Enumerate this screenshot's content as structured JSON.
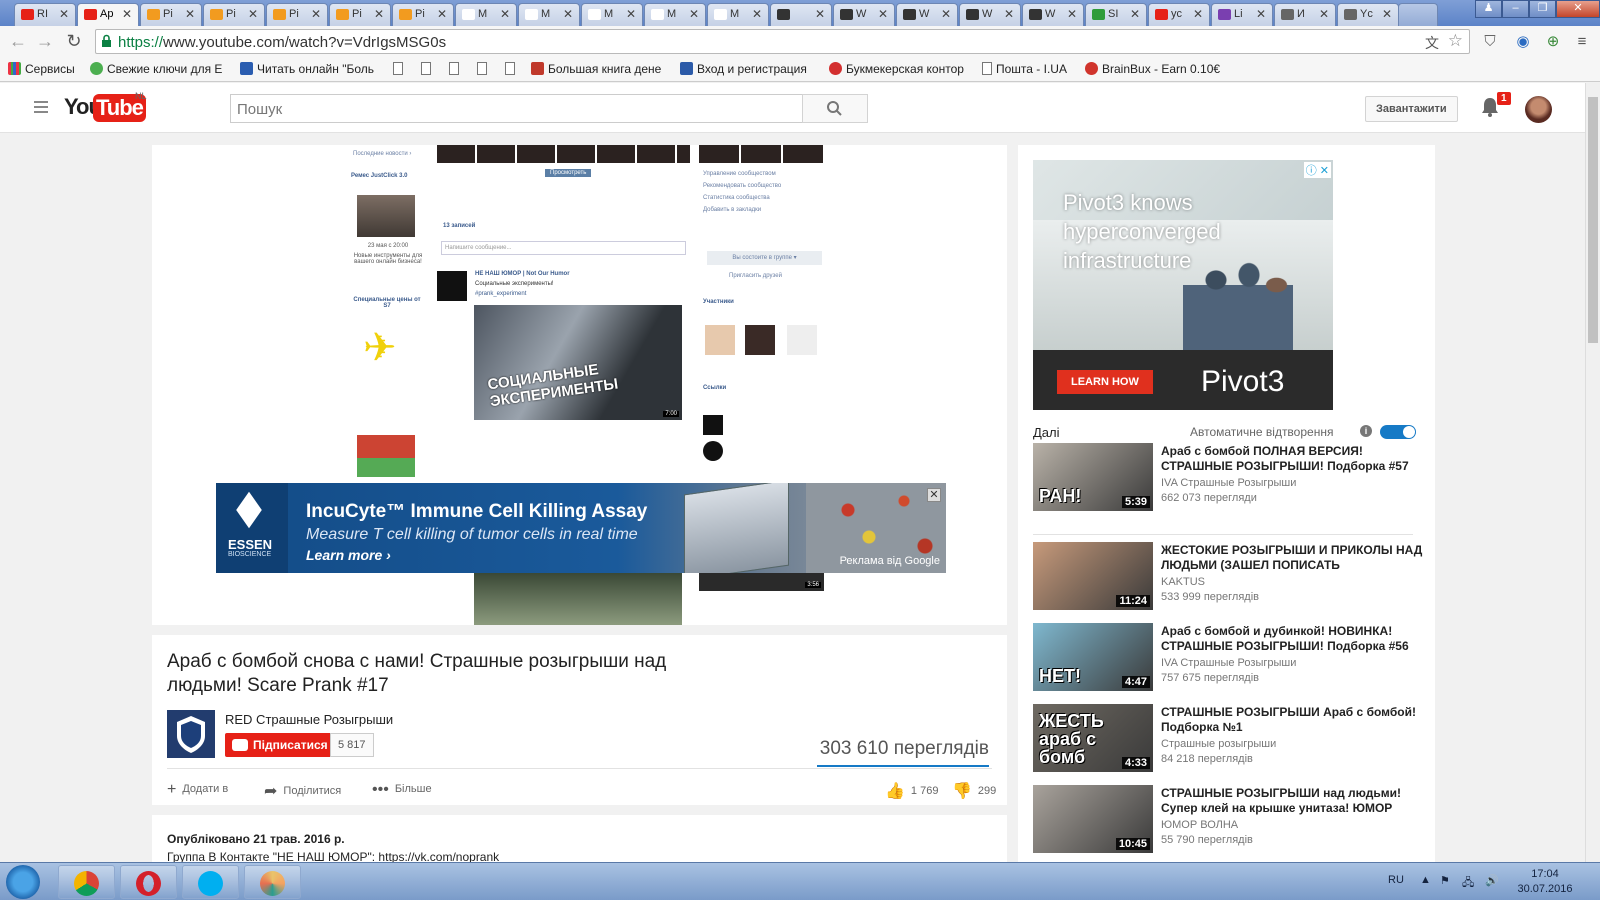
{
  "browser": {
    "tabs": [
      {
        "label": "RI",
        "color": "#e62117"
      },
      {
        "label": "Ap",
        "color": "#e62117"
      },
      {
        "label": "Pi",
        "color": "#f29b1f"
      },
      {
        "label": "Pi",
        "color": "#f29b1f"
      },
      {
        "label": "Pi",
        "color": "#f29b1f"
      },
      {
        "label": "Pi",
        "color": "#f29b1f"
      },
      {
        "label": "Pi",
        "color": "#f29b1f"
      },
      {
        "label": "M",
        "color": "#ffffff"
      },
      {
        "label": "M",
        "color": "#ffffff"
      },
      {
        "label": "M",
        "color": "#ffffff"
      },
      {
        "label": "M",
        "color": "#ffffff"
      },
      {
        "label": "M",
        "color": "#ffffff"
      },
      {
        "label": "",
        "color": "#333333"
      },
      {
        "label": "W",
        "color": "#333333"
      },
      {
        "label": "W",
        "color": "#333333"
      },
      {
        "label": "W",
        "color": "#333333"
      },
      {
        "label": "W",
        "color": "#333333"
      },
      {
        "label": "SI",
        "color": "#2e9c3a"
      },
      {
        "label": "yc",
        "color": "#e62117"
      },
      {
        "label": "Li",
        "color": "#7a3fb0"
      },
      {
        "label": "И",
        "color": "#666666"
      },
      {
        "label": "Yc",
        "color": "#666666"
      }
    ],
    "url_scheme": "https://",
    "url_rest": "www.youtube.com/watch?v=VdrIgsMSG0s",
    "bookmarks": [
      "Сервисы",
      "Свежие ключи для E",
      "Читать онлайн \"Боль",
      "Большая книга дене",
      "Вход и регистрация",
      "Букмекерская контор",
      "Пошта - I.UA",
      "BrainBux - Earn 0.10€"
    ]
  },
  "youtube": {
    "logo_you": "You",
    "logo_tube": "Tube",
    "logo_region": "NL",
    "search_placeholder": "Пошук",
    "upload_label": "Завантажити",
    "notification_count": "1"
  },
  "player": {
    "ad_title": "IncuCyte™ Immune Cell Killing Assay",
    "ad_sub": "Measure T cell killing of tumor cells in real time",
    "ad_learn": "Learn more ›",
    "ad_brand": "ESSEN",
    "ad_brand_sub": "BIOSCIENCE",
    "ad_attribution": "Реклама від Google",
    "ad_close": "✕",
    "screen_text": {
      "latest_news": "Последние новости ›",
      "promo_name": "Ремес JustClick 3.0",
      "promo_date": "23 мая с 20:00",
      "promo_text": "Новые инструменты для вашего онлайн бизнеса!",
      "special_domain": "Специальные цены от S7",
      "post_count": "13 записей",
      "post_placeholder": "Напишите сообщение...",
      "group_name": "НЕ НАШ ЮМОР | Not Our Humor",
      "post_text": "Социальные эксперименты!",
      "hashtag": "#prank_experiment",
      "video_overlay": "СОЦИАЛЬНЫЕ ЭКСПЕРИМЕНТЫ",
      "video_time": "7:00",
      "members": "Участники",
      "links": "Ссылки",
      "join": "Вы состоите в группе ▾",
      "invite": "Пригласить друзей",
      "manage": "Управление сообществом",
      "recommend": "Рекомендовать сообщество",
      "stats": "Статистика сообщества",
      "bookmark": "Добавить в закладки",
      "view_btn": "Просмотреть",
      "second_time": "3:56"
    }
  },
  "video": {
    "title": "Араб с бомбой снова с нами! Страшные розыгрыши над людьми! Scare Prank #17",
    "channel": "RED Страшные Розыгрыши",
    "subscribe_label": "Підписатися",
    "subscriber_count": "5 817",
    "views": "303 610 переглядів",
    "add_to": "Додати в",
    "share": "Поділитися",
    "more": "Більше",
    "likes": "1 769",
    "dislikes": "299",
    "published": "Опубліковано 21 трав. 2016 р.",
    "desc_line": "Группа В Контакте \"НЕ НАШ ЮМОР\": https://vk.com/noprank"
  },
  "sidebar": {
    "ad_headline": "Pivot3 knows hyperconverged infrastructure",
    "ad_cta": "LEARN HOW",
    "ad_brand": "Pivot3",
    "ad_choices": "ⓘ ✕",
    "next_label": "Далі",
    "autoplay_label": "Автоматичне відтворення",
    "recommendations": [
      {
        "title": "Араб с бомбой ПОЛНАЯ ВЕРСИЯ! СТРАШНЫЕ РОЗЫГРЫШИ! Подборка #57",
        "channel": "IVA Страшные Розыгрыши",
        "views": "662 073 перегляди",
        "duration": "5:39",
        "thumb_text": "РАН!",
        "thumb_color": "#b9b2a8"
      },
      {
        "title": "ЖЕСТОКИЕ РОЗЫГРЫШИ И ПРИКОЛЫ НАД ЛЮДЬМИ (ЗАШЕЛ ПОПИСАТЬ",
        "channel": "KAKTUS",
        "views": "533 999 переглядів",
        "duration": "11:24",
        "thumb_text": "",
        "thumb_color": "#c79a7b"
      },
      {
        "title": "Араб с бомбой и дубинкой! НОВИНКА! СТРАШНЫЕ РОЗЫГРЫШИ! Подборка #56",
        "channel": "IVA Страшные Розыгрыши",
        "views": "757 675 переглядів",
        "duration": "4:47",
        "thumb_text": "НЕТ!",
        "thumb_color": "#7fb8cf"
      },
      {
        "title": "СТРАШНЫЕ РОЗЫГРЫШИ Араб с бомбой! Подборка №1",
        "channel": "Страшные розыгрыши",
        "views": "84 218 переглядів",
        "duration": "4:33",
        "thumb_text": "ЖЕСТЬ араб с бомб",
        "thumb_color": "#6f6a62"
      },
      {
        "title": "СТРАШНЫЕ РОЗЫГРЫШИ над людьми! Супер клей на крышке унитаза! ЮМОР",
        "channel": "ЮМОР ВОЛНА",
        "views": "55 790 переглядів",
        "duration": "10:45",
        "thumb_text": "",
        "thumb_color": "#a9a39c"
      }
    ]
  },
  "taskbar": {
    "lang": "RU",
    "time": "17:04",
    "date": "30.07.2016"
  }
}
